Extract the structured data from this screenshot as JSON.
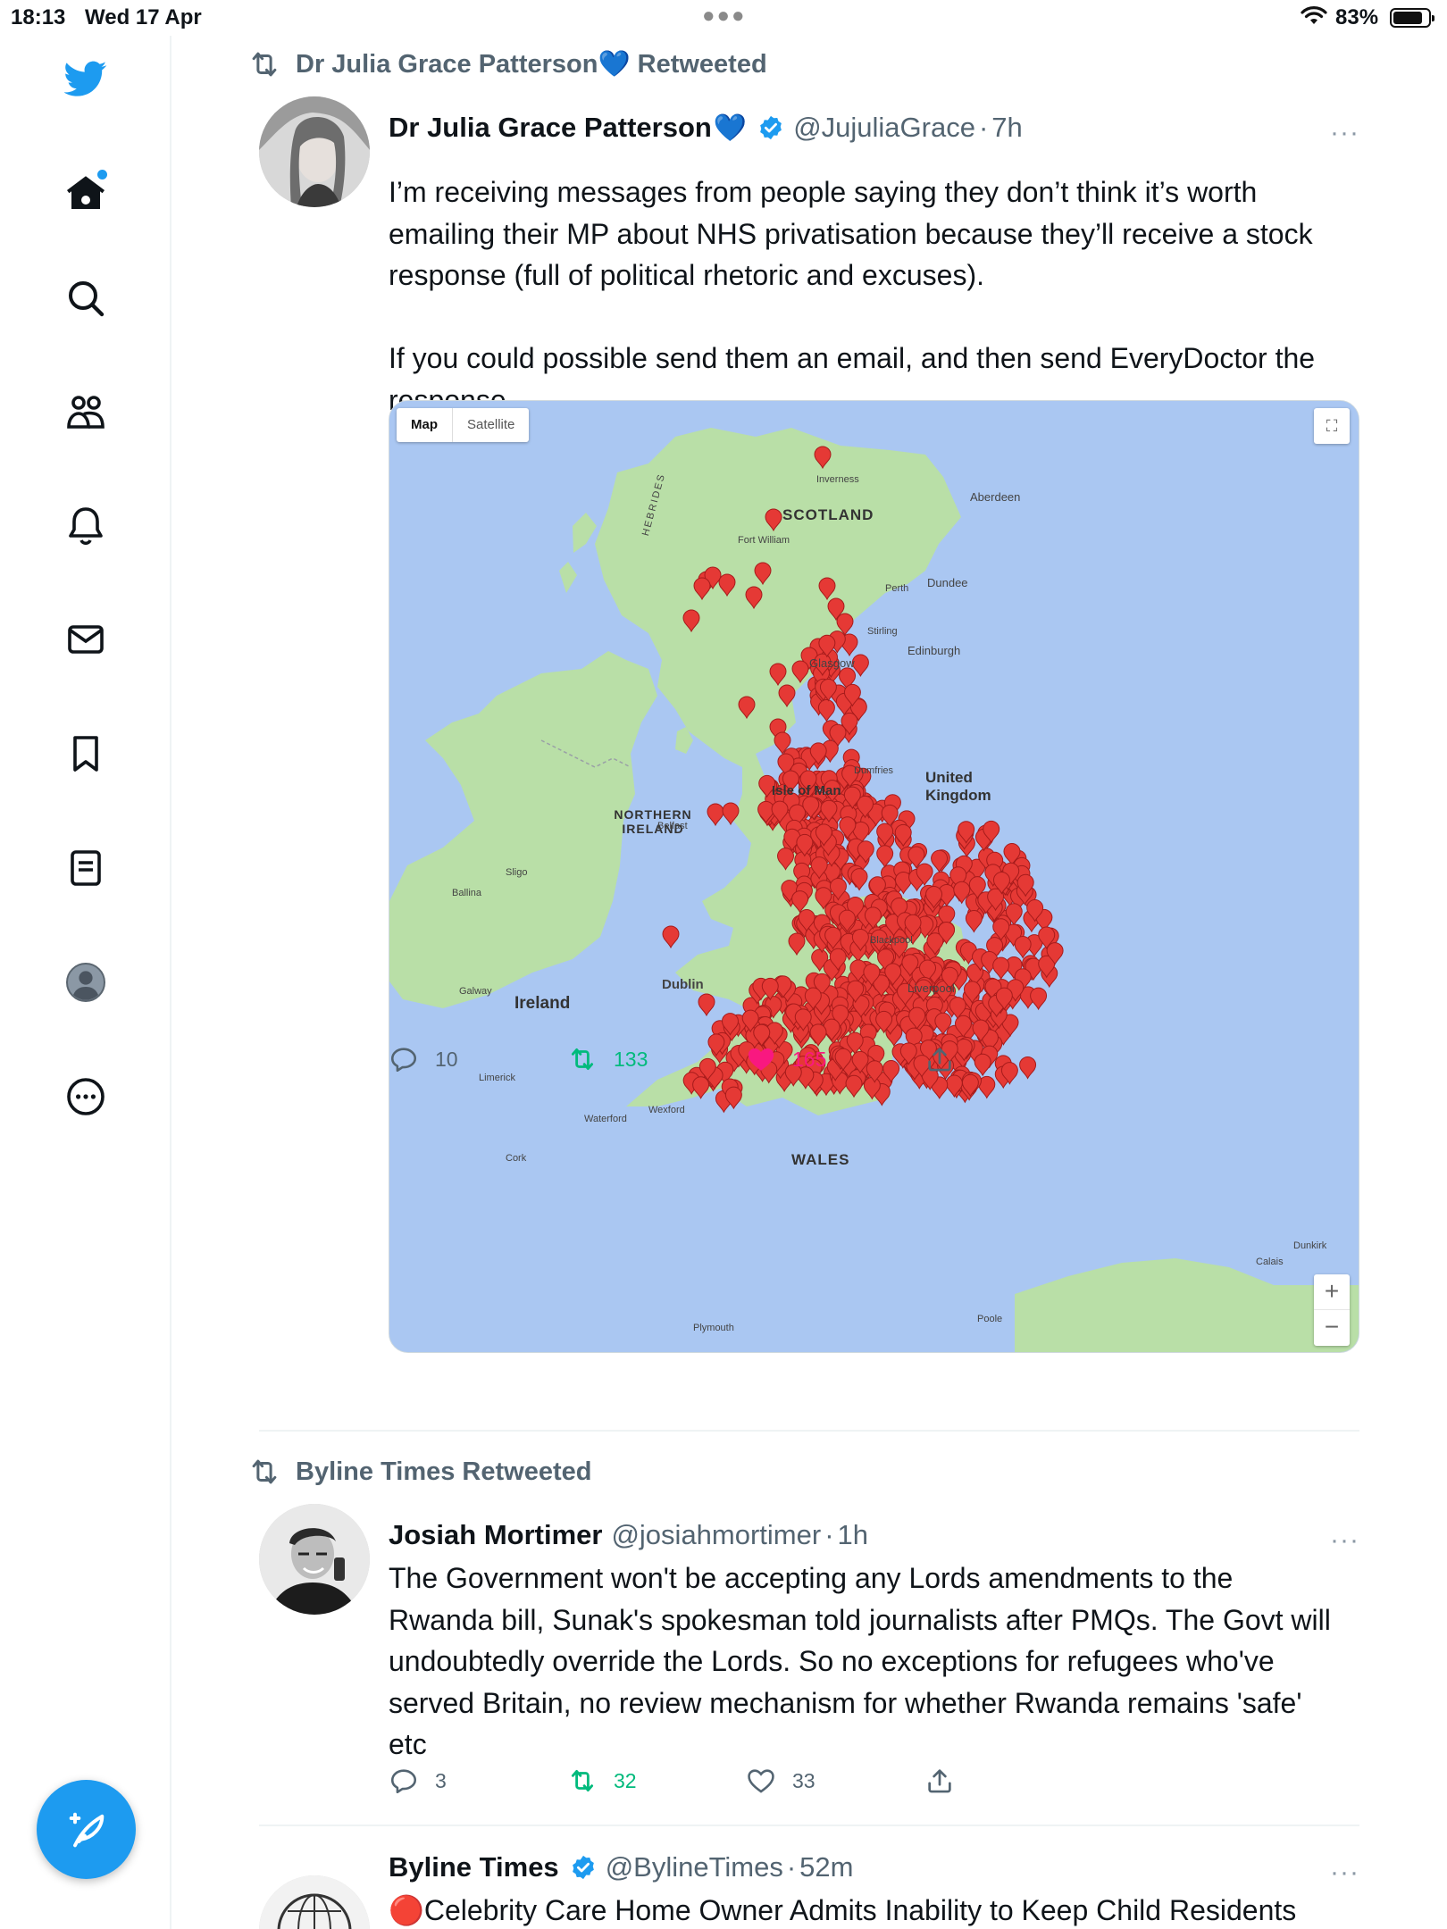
{
  "status_bar": {
    "time": "18:13",
    "date": "Wed 17 Apr",
    "battery": "83%",
    "battery_level": 0.83
  },
  "sidebar": {
    "items": [
      {
        "icon": "twitter-bird-icon"
      },
      {
        "icon": "home-icon"
      },
      {
        "icon": "search-icon"
      },
      {
        "icon": "communities-icon"
      },
      {
        "icon": "bell-icon"
      },
      {
        "icon": "mail-icon"
      },
      {
        "icon": "bookmark-icon"
      },
      {
        "icon": "lists-icon"
      },
      {
        "icon": "profile-icon"
      },
      {
        "icon": "more-icon"
      }
    ],
    "compose_icon": "feather-plus-icon",
    "accent": "#1d9bf0"
  },
  "tweets": [
    {
      "retweeted_by": "Dr Julia Grace Patterson💙 Retweeted",
      "name": "Dr Julia Grace Patterson",
      "name_emoji": "💙",
      "handle": "@JujuliaGrace",
      "sep": "·",
      "time": "7h",
      "more": "···",
      "text": "I’m receiving messages from people saying they don’t think it’s worth emailing their MP about NHS privatisation because they’ll receive a stock response (full of political rhetoric and excuses).\n\nIf you could possible send them an email, and then send EveryDoctor the response…",
      "media": {
        "tab_map": "Map",
        "tab_satellite": "Satellite",
        "labels": {
          "scotland": "SCOTLAND",
          "hebrides": "HEBRIDES",
          "northern_ireland": "NORTHERN IRELAND",
          "ireland": "Ireland",
          "isle_of_man": "Isle of Man",
          "united_kingdom": "United Kingdom",
          "wales": "WALES",
          "dublin": "Dublin",
          "edinburgh": "Edinburgh",
          "glasgow": "Glasgow",
          "liverpool": "Liverpool",
          "aberdeen": "Aberdeen",
          "dundee": "Dundee",
          "belfast": "Belfast",
          "cork": "Cork",
          "galway": "Galway",
          "inverness": "Inverness",
          "plymouth": "Plymouth",
          "poole": "Poole",
          "calais": "Calais",
          "dunkirk": "Dunkirk",
          "fort_william": "Fort William",
          "blackpool": "Blackpool",
          "limerick": "Limerick",
          "sligo": "Sligo",
          "waterford": "Waterford",
          "wexford": "Wexford",
          "ballina": "Ballina",
          "dumfries": "Dumfries",
          "stirling": "Stirling",
          "perth": "Perth"
        },
        "zoom_in": "+",
        "zoom_out": "−",
        "water_color": "#aac7f2",
        "land_color": "#b9dfa7",
        "pin_color": "#e53935"
      },
      "replies": "10",
      "retweets": "133",
      "likes": "165",
      "liked": true
    },
    {
      "retweeted_by": "Byline Times Retweeted",
      "name": "Josiah Mortimer",
      "handle": "@josiahmortimer",
      "sep": "·",
      "time": "1h",
      "more": "···",
      "text": "The Government won't be accepting any Lords amendments to the Rwanda bill, Sunak's spokesman told journalists after PMQs. The Govt will undoubtedly override the Lords. So no exceptions for refugees who've served Britain, no review mechanism for whether Rwanda remains 'safe' etc",
      "replies": "3",
      "retweets": "32",
      "likes": "33",
      "liked": false
    },
    {
      "name": "Byline Times",
      "handle": "@BylineTimes",
      "sep": "·",
      "time": "52m",
      "more": "···",
      "text": "🔴Celebrity Care Home Owner Admits Inability to Keep Child Residents"
    }
  ]
}
